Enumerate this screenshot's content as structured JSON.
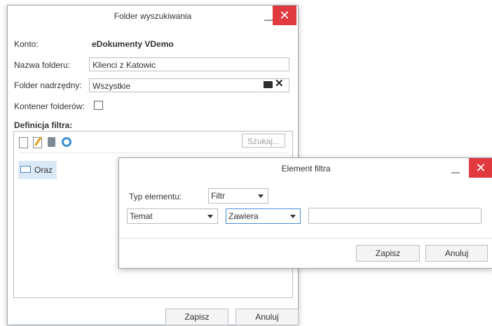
{
  "main_dialog": {
    "title": "Folder wyszukiwania",
    "konto_label": "Konto:",
    "konto_value": "eDokumenty VDemo",
    "nazwa_label": "Nazwa folderu:",
    "nazwa_value": "Klienci z Katowic",
    "nadrzedny_label": "Folder nadrzędny:",
    "nadrzedny_value": "Wszystkie",
    "kontener_label": "Kontener folderów:",
    "definicja_label": "Definicja filtra:",
    "search_placeholder": "Szukaj...",
    "tree_item": "Oraz",
    "save_label": "Zapisz",
    "cancel_label": "Anuluj"
  },
  "filter_dialog": {
    "title": "Element filtra",
    "typ_label": "Typ elementu:",
    "typ_value": "Filtr",
    "field_value": "Temat",
    "op_value": "Zawiera",
    "text_value": "",
    "save_label": "Zapisz",
    "cancel_label": "Anuluj"
  },
  "colors": {
    "close_button": "#e0393e",
    "selected_item": "#dbe9f7",
    "folder_icon": "#3f86c8"
  }
}
